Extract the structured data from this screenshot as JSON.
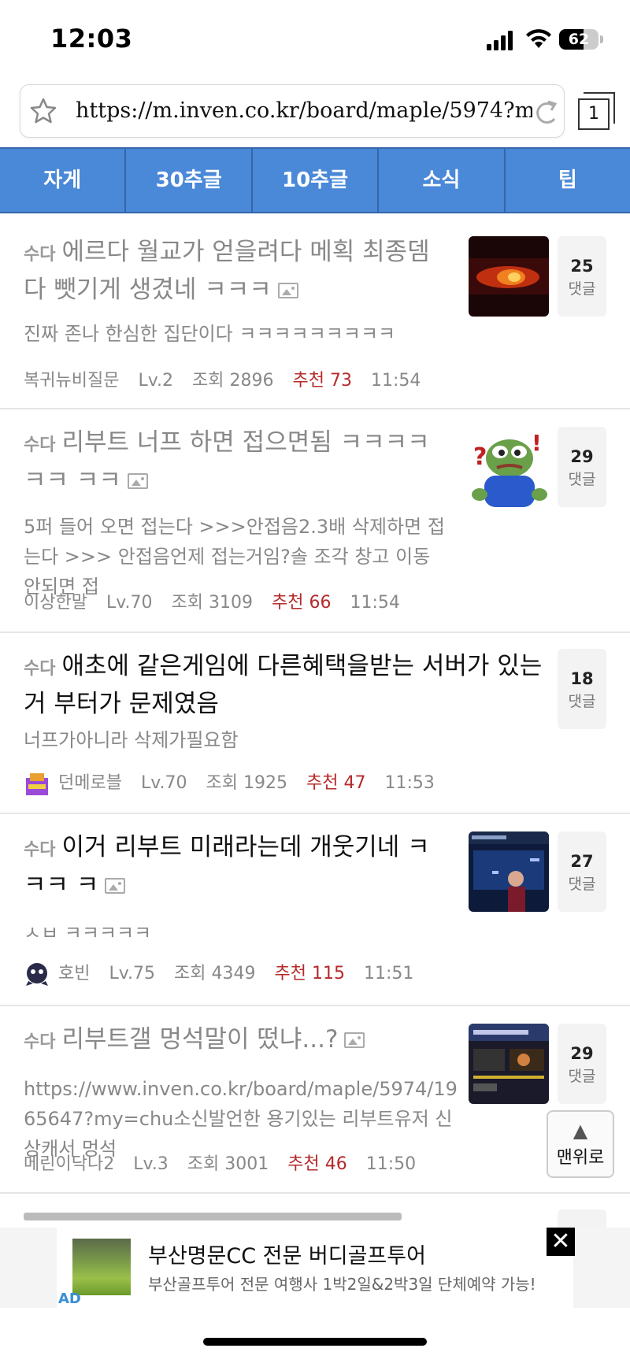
{
  "status": {
    "time": "12:03",
    "battery": "62",
    "battery_level": 0.62
  },
  "browser": {
    "url": "https://m.inven.co.kr/board/maple/5974?m…",
    "tab_count": "1"
  },
  "nav": {
    "tabs": [
      "자게",
      "30추글",
      "10추글",
      "소식",
      "팁"
    ]
  },
  "posts": [
    {
      "category": "수다",
      "title": "에르다 월교가 얻을려다 메획 최종뎀 다 뺏기게 생겼네 ㅋㅋㅋ",
      "preview": "진짜 존나 한심한 집단이다 ㅋㅋㅋㅋㅋㅋㅋㅋㅋ",
      "author": "복귀뉴비질문",
      "level": "Lv.2",
      "views": "조회 2896",
      "recommend": "추천 73",
      "time": "11:54",
      "comments": "25",
      "comments_label": "댓글"
    },
    {
      "category": "수다",
      "title": "리부트 너프 하면 접으면됨 ㅋㅋㅋㅋㅋㅋ ㅋㅋ",
      "preview": "5퍼 들어 오면 접는다 >>>안접음2.3배 삭제하면 접는다 >>> 안접음언제 접는거임?솔 조각 창고 이동 안되면 접",
      "author": "이상한말",
      "level": "Lv.70",
      "views": "조회 3109",
      "recommend": "추천 66",
      "time": "11:54",
      "comments": "29",
      "comments_label": "댓글"
    },
    {
      "category": "수다",
      "title": "애초에 같은게임에 다른혜택을받는 서버가 있는거 부터가 문제였음",
      "preview": "너프가아니라 삭제가필요함",
      "author": "던메로블",
      "level": "Lv.70",
      "views": "조회 1925",
      "recommend": "추천 47",
      "time": "11:53",
      "comments": "18",
      "comments_label": "댓글"
    },
    {
      "category": "수다",
      "title": "이거 리부트 미래라는데 개웃기네 ㅋㅋㅋ ㅋ",
      "preview": "ㅅㅂ ㅋㅋㅋㅋㅋ",
      "author": "호빈",
      "level": "Lv.75",
      "views": "조회 4349",
      "recommend": "추천 115",
      "time": "11:51",
      "comments": "27",
      "comments_label": "댓글"
    },
    {
      "category": "수다",
      "title": "리부트갤 멍석말이 떴냐...?",
      "preview": "https://www.inven.co.kr/board/maple/5974/1965647?my=chu소신발언한 용기있는 리부트유저 신상캐서 멍석",
      "author": "메린이닥나2",
      "level": "Lv.3",
      "views": "조회 3001",
      "recommend": "추천 46",
      "time": "11:50",
      "comments": "29",
      "comments_label": "댓글"
    }
  ],
  "scroll_top": {
    "arrow": "▲",
    "label": "맨위로"
  },
  "ad": {
    "badge": "AD",
    "title": "부산명문CC 전문 버디골프투어",
    "description": "부산골프투어 전문 여행사 1박2일&2박3일 단체예약 가능!",
    "close": "✕"
  }
}
